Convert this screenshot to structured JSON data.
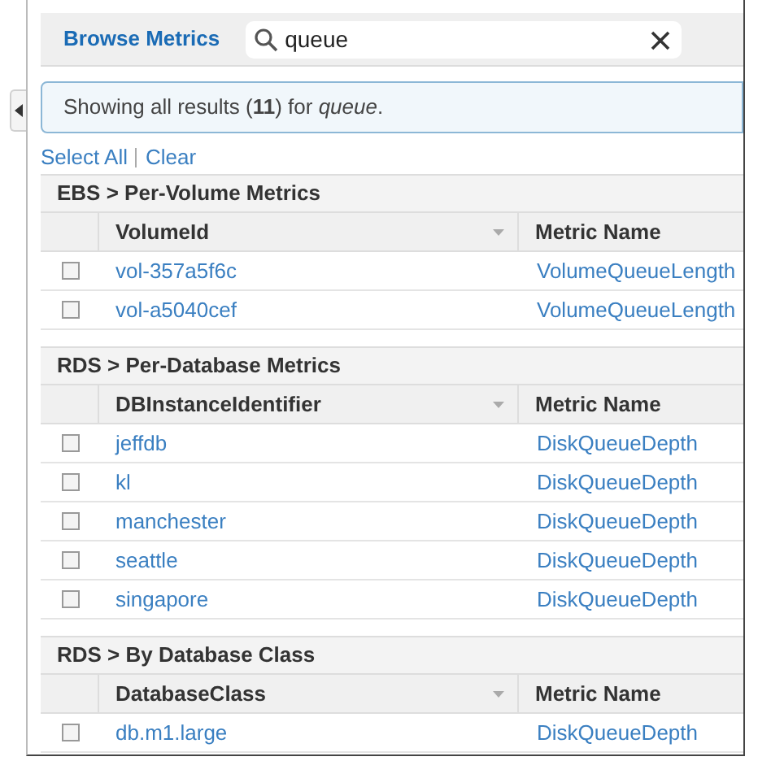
{
  "header": {
    "title": "Browse Metrics",
    "search": {
      "value": "queue"
    }
  },
  "message": "Showing all results (**11**) for *queue*.",
  "selection_links": [
    "Select All",
    "Clear"
  ],
  "sections": [
    {
      "title": "EBS > Per-Volume Metrics",
      "columns": [
        "VolumeId",
        "Metric Name"
      ],
      "rows": [
        {
          "name": "vol-357a5f6c",
          "metric": "VolumeQueueLength",
          "checked": false
        },
        {
          "name": "vol-a5040cef",
          "metric": "VolumeQueueLength",
          "checked": false
        }
      ]
    },
    {
      "title": "RDS > Per-Database Metrics",
      "columns": [
        "DBInstanceIdentifier",
        "Metric Name"
      ],
      "rows": [
        {
          "name": "jeffdb",
          "metric": "DiskQueueDepth",
          "checked": false
        },
        {
          "name": "kl",
          "metric": "DiskQueueDepth",
          "checked": false
        },
        {
          "name": "manchester",
          "metric": "DiskQueueDepth",
          "checked": false
        },
        {
          "name": "seattle",
          "metric": "DiskQueueDepth",
          "checked": false
        },
        {
          "name": "singapore",
          "metric": "DiskQueueDepth",
          "checked": false
        }
      ]
    },
    {
      "title": "RDS > By Database Class",
      "columns": [
        "DatabaseClass",
        "Metric Name"
      ],
      "rows": [
        {
          "name": "db.m1.large",
          "metric": "DiskQueueDepth",
          "checked": false
        }
      ]
    }
  ]
}
